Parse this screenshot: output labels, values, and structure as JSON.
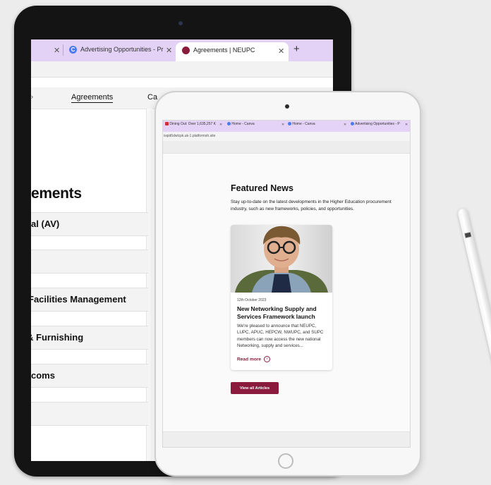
{
  "back_browser": {
    "tabs": [
      {
        "title": "Advertising Opportunities - Pr",
        "favicon": "c-icon",
        "favicon_color": "#4b7bec"
      },
      {
        "title": "Agreements | NEUPC",
        "favicon": "neupc-icon",
        "favicon_color": "#8a1b3d",
        "active": true
      }
    ],
    "new_tab_glyph": "+",
    "nav_items": [
      "Agreements",
      "Ca"
    ],
    "page_heading": "ements",
    "rows": [
      "al (AV)",
      "",
      "Facilities Management",
      "& Furnishing",
      "coms",
      ""
    ]
  },
  "front_browser": {
    "tabs": [
      {
        "title": "Dining Out: Over 1,635,257 K",
        "favicon_color": "#d32f2f"
      },
      {
        "title": "Home - Canva",
        "favicon_color": "#4b7bec"
      },
      {
        "title": "Home - Canva",
        "favicon_color": "#4b7bec"
      },
      {
        "title": "Advertising Opportunities - P",
        "favicon_color": "#4b7bec"
      }
    ],
    "url": "isqid6dwlcpk.uk-1.platformsh.site",
    "page": {
      "featured_title": "Featured News",
      "featured_description": "Stay up-to-date on the latest developments in the Higher Education procurement industry, such as new frameworks, policies, and opportunities.",
      "article": {
        "date": "12th October 2023",
        "title": "New Networking Supply and Services Framework launch",
        "excerpt": "We're pleased to announce that NEUPC, LUPC, APUC, HEPCW, NWUPC, and SUPC members can now access the new national Networking, supply and services...",
        "read_more": "Read more"
      },
      "view_all_label": "View all Articles"
    }
  },
  "colors": {
    "accent": "#8a1b3d",
    "tabbar": "#e3d2f6"
  }
}
